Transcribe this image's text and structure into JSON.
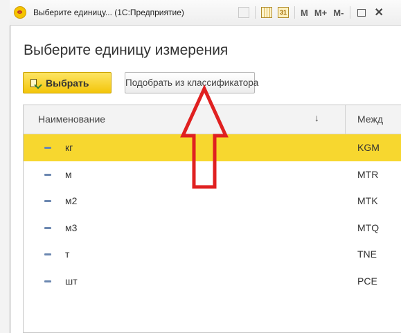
{
  "window": {
    "title": "Выберите единицу... (1С:Предприятие)",
    "toolbar": {
      "m": "M",
      "m_plus": "M+",
      "m_minus": "M-"
    }
  },
  "form": {
    "title": "Выберите единицу измерения",
    "select_button": "Выбрать",
    "pick_button": "Подобрать из классификатора"
  },
  "table": {
    "columns": {
      "name": "Наименование",
      "sort_indicator": "↓",
      "intl": "Межд"
    },
    "rows": [
      {
        "name": "кг",
        "code": "KGM",
        "selected": true
      },
      {
        "name": "м",
        "code": "MTR",
        "selected": false
      },
      {
        "name": "м2",
        "code": "MTK",
        "selected": false
      },
      {
        "name": "м3",
        "code": "MTQ",
        "selected": false
      },
      {
        "name": "т",
        "code": "TNE",
        "selected": false
      },
      {
        "name": "шт",
        "code": "PCE",
        "selected": false
      }
    ]
  },
  "annotation": {
    "arrow_color": "#e02020",
    "icon": "up-arrow-outline-icon"
  },
  "colors": {
    "selected_row": "#f7d72f",
    "primary_button": "#f5cd1c"
  }
}
